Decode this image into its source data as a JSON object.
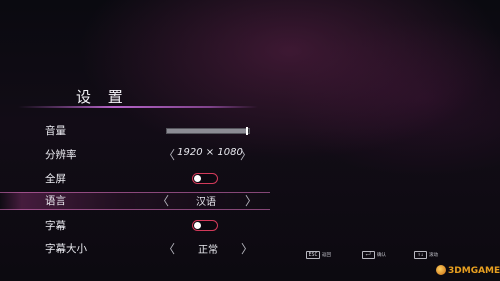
{
  "menu": {
    "title": "设 置"
  },
  "settings": [
    {
      "label": "音量",
      "control": "slider",
      "level": 0.99
    },
    {
      "label": "分辨率",
      "control": "selector",
      "value": "1920 × 1080"
    },
    {
      "label": "全屏",
      "control": "toggle"
    },
    {
      "label": "语言",
      "control": "selector",
      "value": "汉语",
      "selected": true
    },
    {
      "label": "字幕",
      "control": "toggle"
    },
    {
      "label": "字幕大小",
      "control": "selector",
      "value": "正常"
    }
  ],
  "arrows": {
    "left": "〈",
    "right": "〉"
  },
  "hints": [
    {
      "key": "ESC",
      "action": "返回"
    },
    {
      "key": "←┘",
      "action": "确认"
    },
    {
      "key": "↑↓",
      "action": "滚动"
    }
  ],
  "watermark": {
    "text": "3DMGAME"
  },
  "colors": {
    "accent": "#d23a5a",
    "highlight": "#c86ab4"
  }
}
